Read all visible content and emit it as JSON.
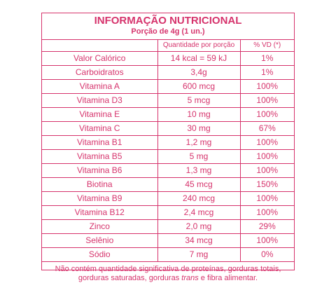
{
  "table": {
    "title": "INFORMAÇÃO NUTRICIONAL",
    "subtitle": "Porção de 4g (1 un.)",
    "columns": [
      "",
      "Quantidade por porção",
      "% VD (*)"
    ],
    "rows": [
      {
        "name": "Valor Calórico",
        "amount": "14 kcal = 59 kJ",
        "vd": "1%"
      },
      {
        "name": "Carboidratos",
        "amount": "3,4g",
        "vd": "1%"
      },
      {
        "name": "Vitamina A",
        "amount": "600 mcg",
        "vd": "100%"
      },
      {
        "name": "Vitamina D3",
        "amount": "5 mcg",
        "vd": "100%"
      },
      {
        "name": "Vitamina E",
        "amount": "10 mg",
        "vd": "100%"
      },
      {
        "name": "Vitamina C",
        "amount": "30 mg",
        "vd": "67%"
      },
      {
        "name": "Vitamina B1",
        "amount": "1,2 mg",
        "vd": "100%"
      },
      {
        "name": "Vitamina B5",
        "amount": "5 mg",
        "vd": "100%"
      },
      {
        "name": "Vitamina B6",
        "amount": "1,3 mg",
        "vd": "100%"
      },
      {
        "name": "Biotina",
        "amount": "45 mcg",
        "vd": "150%"
      },
      {
        "name": "Vitamina B9",
        "amount": "240 mcg",
        "vd": "100%"
      },
      {
        "name": "Vitamina B12",
        "amount": "2,4 mcg",
        "vd": "100%"
      },
      {
        "name": "Zinco",
        "amount": "2,0 mg",
        "vd": "29%"
      },
      {
        "name": "Selênio",
        "amount": "34 mcg",
        "vd": "100%"
      },
      {
        "name": "Sódio",
        "amount": "7 mg",
        "vd": "0%"
      }
    ],
    "footnote": {
      "line1": "Não contém quantidade significativa de proteínas, gorduras totais,",
      "line2_before": "gorduras saturadas, gorduras ",
      "line2_italic": "trans",
      "line2_after": " e fibra alimentar."
    }
  },
  "colors": {
    "accent": "#d6336c"
  }
}
